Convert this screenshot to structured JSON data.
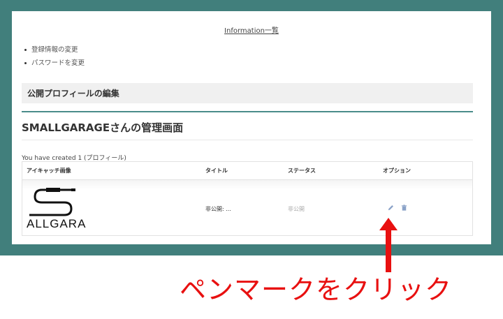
{
  "header": {
    "info_link": "Information一覧"
  },
  "menu": [
    {
      "label": "登録情報の変更"
    },
    {
      "label": "パスワードを変更"
    }
  ],
  "profile_section": {
    "title": "公開プロフィールの編集"
  },
  "manage": {
    "title": "SMALLGARAGEさんの管理画面"
  },
  "summary": {
    "count_text": "You have created 1 (プロフィール)"
  },
  "table": {
    "headers": [
      "アイキャッチ画像",
      "タイトル",
      "ステータス",
      "オプション"
    ],
    "rows": [
      {
        "thumbnail_text": "ALLGARA",
        "title": "非公開: ...",
        "status": "非公開",
        "options": [
          "pencil-icon",
          "trash-icon"
        ]
      }
    ]
  },
  "annotation": {
    "text": "ペンマークをクリック",
    "color": "#e81010"
  },
  "colors": {
    "frame": "#417f7c",
    "accent_rule": "#4a8c8a",
    "icon": "#8aa2c8"
  }
}
